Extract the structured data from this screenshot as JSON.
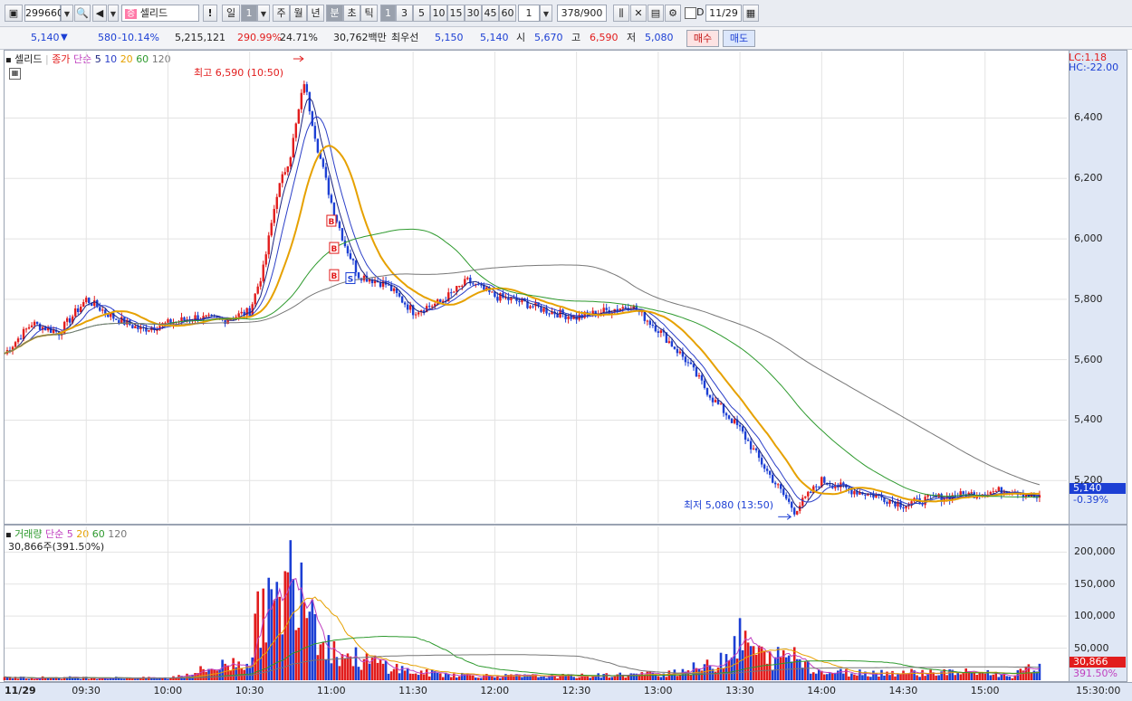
{
  "toolbar": {
    "code": "299660",
    "stock_name": "셀리드",
    "alert_label": "!",
    "day_label": "일",
    "day_count": "1",
    "week_label": "주",
    "month_label": "월",
    "year_label": "년",
    "minute_label": "분",
    "second_label": "초",
    "tick_label": "틱",
    "periods": [
      "1",
      "3",
      "5",
      "10",
      "15",
      "30",
      "45",
      "60"
    ],
    "period_value": "1",
    "count_display": "378/900",
    "date_checkbox_label": "D",
    "date_value": "11/29"
  },
  "quote": {
    "price": "5,140",
    "change": "580",
    "change_pct": "-10.14%",
    "volume": "5,215,121",
    "volume_ratio": "290.99%",
    "turnover": "24.71%",
    "amount": "30,762백만",
    "best_label": "최우선",
    "best_ask": "5,150",
    "best_bid": "5,140",
    "open_label": "시",
    "open": "5,670",
    "high_label": "고",
    "high": "6,590",
    "low_label": "저",
    "low": "5,080",
    "buy_label": "매수",
    "sell_label": "매도"
  },
  "price_panel": {
    "title": "셀리드",
    "legend": {
      "kind": "종가",
      "type": "단순",
      "p5": "5",
      "p10": "10",
      "p20": "20",
      "p60": "60",
      "p120": "120"
    },
    "lc": "LC:1.18",
    "hc": "HC:-22.00",
    "high_note": "최고 6,590 (10:50)",
    "low_note": "최저 5,080 (13:50)",
    "current_price": "5,140",
    "current_pct": "-0.39%",
    "signals": [
      "B",
      "B",
      "B",
      "S"
    ]
  },
  "volume_panel": {
    "title": "거래량",
    "legend": {
      "type": "단순",
      "p5": "5",
      "p20": "20",
      "p60": "60",
      "p120": "120"
    },
    "current_line": "30,866주(391.50%)",
    "current_value": "30,866",
    "current_pct": "391.50%"
  },
  "time_axis": {
    "date": "11/29",
    "ticks": [
      "09:30",
      "10:00",
      "10:30",
      "11:00",
      "11:30",
      "12:00",
      "12:30",
      "13:00",
      "13:30",
      "14:00",
      "14:30",
      "15:00",
      "15:30:00"
    ]
  },
  "colors": {
    "up": "#e21d1d",
    "down": "#1c3fd4",
    "ma5": "#1a237e",
    "ma10": "#2b3fc8",
    "ma20": "#e6a100",
    "ma60": "#2e9a2e",
    "ma120": "#777777",
    "vma5": "#c040c0"
  },
  "chart_data": [
    {
      "type": "line",
      "title": "셀리드",
      "ylim": [
        5060,
        6620
      ],
      "yticks": [
        5200,
        5400,
        5600,
        5800,
        6000,
        6200,
        6400
      ],
      "x": [
        "09:00",
        "09:10",
        "09:20",
        "09:30",
        "09:40",
        "09:50",
        "10:00",
        "10:10",
        "10:20",
        "10:30",
        "10:35",
        "10:40",
        "10:45",
        "10:50",
        "10:55",
        "11:00",
        "11:05",
        "11:10",
        "11:20",
        "11:30",
        "11:40",
        "11:50",
        "12:00",
        "12:10",
        "12:20",
        "12:30",
        "12:40",
        "12:50",
        "13:00",
        "13:10",
        "13:20",
        "13:30",
        "13:40",
        "13:50",
        "14:00",
        "14:10",
        "14:20",
        "14:30",
        "14:40",
        "14:50",
        "15:00",
        "15:10",
        "15:20"
      ],
      "series": [
        {
          "name": "종가",
          "values": [
            5620,
            5720,
            5690,
            5800,
            5740,
            5700,
            5720,
            5740,
            5730,
            5760,
            5900,
            6150,
            6280,
            6520,
            6300,
            6120,
            5980,
            5880,
            5850,
            5760,
            5790,
            5860,
            5810,
            5790,
            5760,
            5740,
            5760,
            5780,
            5700,
            5600,
            5470,
            5370,
            5230,
            5100,
            5200,
            5170,
            5150,
            5120,
            5140,
            5150,
            5160,
            5170,
            5140
          ]
        }
      ]
    },
    {
      "type": "bar",
      "title": "거래량",
      "ylim": [
        0,
        240000
      ],
      "yticks": [
        50000,
        100000,
        150000,
        200000
      ],
      "x": [
        "09:00",
        "09:30",
        "10:00",
        "10:30",
        "10:35",
        "10:40",
        "10:45",
        "10:50",
        "10:55",
        "11:00",
        "11:10",
        "11:20",
        "11:30",
        "12:00",
        "12:30",
        "13:00",
        "13:20",
        "13:30",
        "13:40",
        "13:50",
        "14:00",
        "14:30",
        "15:00",
        "15:10",
        "15:20"
      ],
      "values": [
        5000,
        5000,
        4000,
        40000,
        160000,
        130000,
        205000,
        225000,
        110000,
        60000,
        40000,
        30000,
        15000,
        8000,
        8000,
        12000,
        28000,
        80000,
        40000,
        50000,
        15000,
        15000,
        15000,
        8000,
        30866
      ]
    }
  ]
}
